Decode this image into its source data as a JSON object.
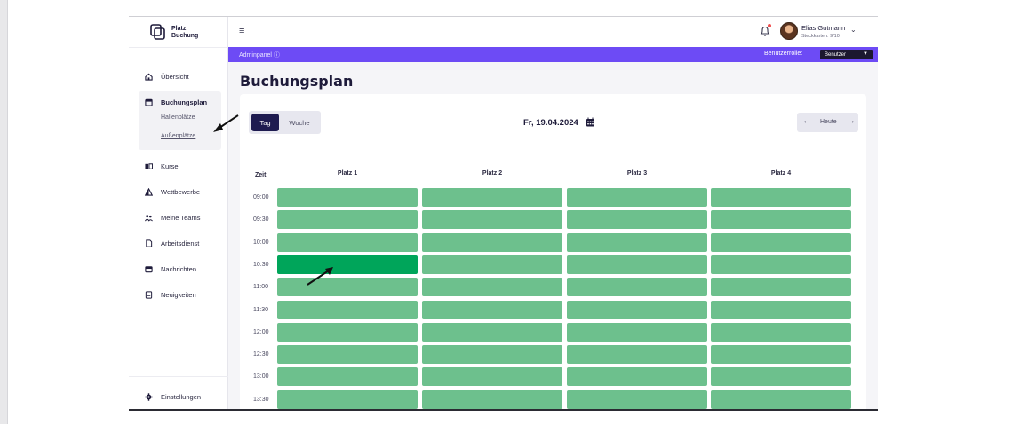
{
  "app": {
    "logo_line1": "Platz",
    "logo_line2": "Buchung"
  },
  "user": {
    "name": "Elias Gutmann",
    "sub": "Steckkarten: 9/10"
  },
  "adminbar": {
    "label": "Adminpanel ⓘ",
    "role_label": "Benutzerrolle:",
    "role_value": "Benutzer"
  },
  "sidebar": {
    "items": [
      {
        "label": "Übersicht",
        "icon": "home-icon"
      },
      {
        "label": "Buchungsplan",
        "icon": "calendar-icon"
      },
      {
        "label": "Kurse",
        "icon": "book-icon"
      },
      {
        "label": "Wettbewerbe",
        "icon": "triangle-icon"
      },
      {
        "label": "Meine Teams",
        "icon": "team-icon"
      },
      {
        "label": "Arbeitsdienst",
        "icon": "document-icon"
      },
      {
        "label": "Nachrichten",
        "icon": "mail-icon"
      },
      {
        "label": "Neuigkeiten",
        "icon": "news-icon"
      }
    ],
    "sub_items": [
      {
        "label": "Hallenplätze"
      },
      {
        "label": "Außenplätze"
      }
    ],
    "settings": "Einstellungen"
  },
  "page": {
    "title": "Buchungsplan",
    "view_tag": "Tag",
    "view_woche": "Woche",
    "date": "Fr, 19.04.2024",
    "today": "Heute",
    "zeit": "Zeit",
    "courts": [
      "Platz 1",
      "Platz 2",
      "Platz 3",
      "Platz 4"
    ],
    "times": [
      "09:00",
      "09:30",
      "10:00",
      "10:30",
      "11:00",
      "11:30",
      "12:00",
      "12:30",
      "13:00",
      "13:30"
    ]
  },
  "colors": {
    "accent": "#6d4bf5",
    "free_slot": "#6dc08d",
    "booked_slot": "#00a55a",
    "active_toggle": "#1e1b50"
  },
  "booked_slots": [
    {
      "time": "10:30",
      "court": "Platz 1"
    }
  ]
}
